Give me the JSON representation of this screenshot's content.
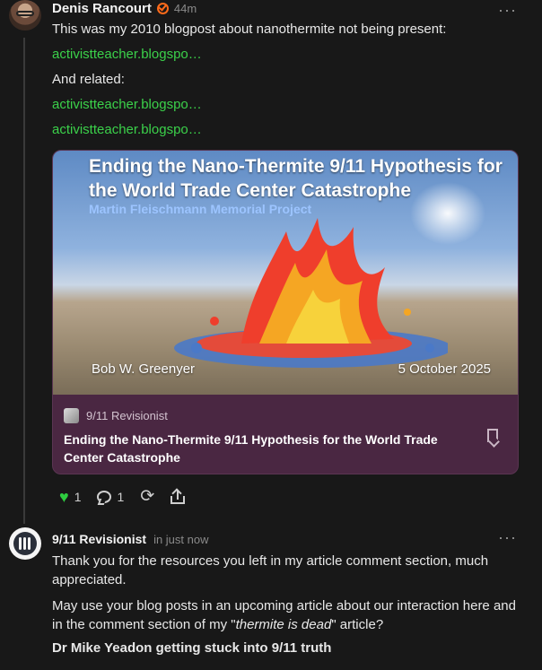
{
  "post": {
    "author": "Denis Rancourt",
    "time": "44m",
    "lines": [
      "This was my 2010 blogpost about nanothermite not being present:",
      "activistteacher.blogspo…",
      "And related:",
      "activistteacher.blogspo…",
      "activistteacher.blogspo…"
    ],
    "card": {
      "image_title": "Ending the Nano-Thermite 9/11 Hypothesis for the World Trade Center Catastrophe",
      "image_subtitle": "Martin Fleischmann Memorial Project",
      "image_author": "Bob W. Greenyer",
      "image_date": "5 October 2025",
      "publication": "9/11 Revisionist",
      "title": "Ending the Nano-Thermite 9/11 Hypothesis for the World Trade Center Catastrophe"
    },
    "actions": {
      "likes": "1",
      "comments": "1"
    }
  },
  "reply": {
    "author": "9/11 Revisionist",
    "time": "in just now",
    "p1": "Thank you for the resources you left in my article comment section, much appreciated.",
    "p2_a": "May use your blog posts in an upcoming article about our interaction here and in the comment section of my \"",
    "p2_em": "thermite is dead",
    "p2_b": "\" article?",
    "p3": "Dr Mike Yeadon getting stuck into 9/11 truth"
  },
  "colors": {
    "link": "#3bd14a",
    "card_bg": "#4a2742",
    "heart": "#2ecc40",
    "verified": "#ff6a1a"
  },
  "icons": [
    "verified-icon",
    "more-icon",
    "bookmark-icon",
    "heart-icon",
    "comment-icon",
    "repost-icon",
    "share-icon"
  ]
}
